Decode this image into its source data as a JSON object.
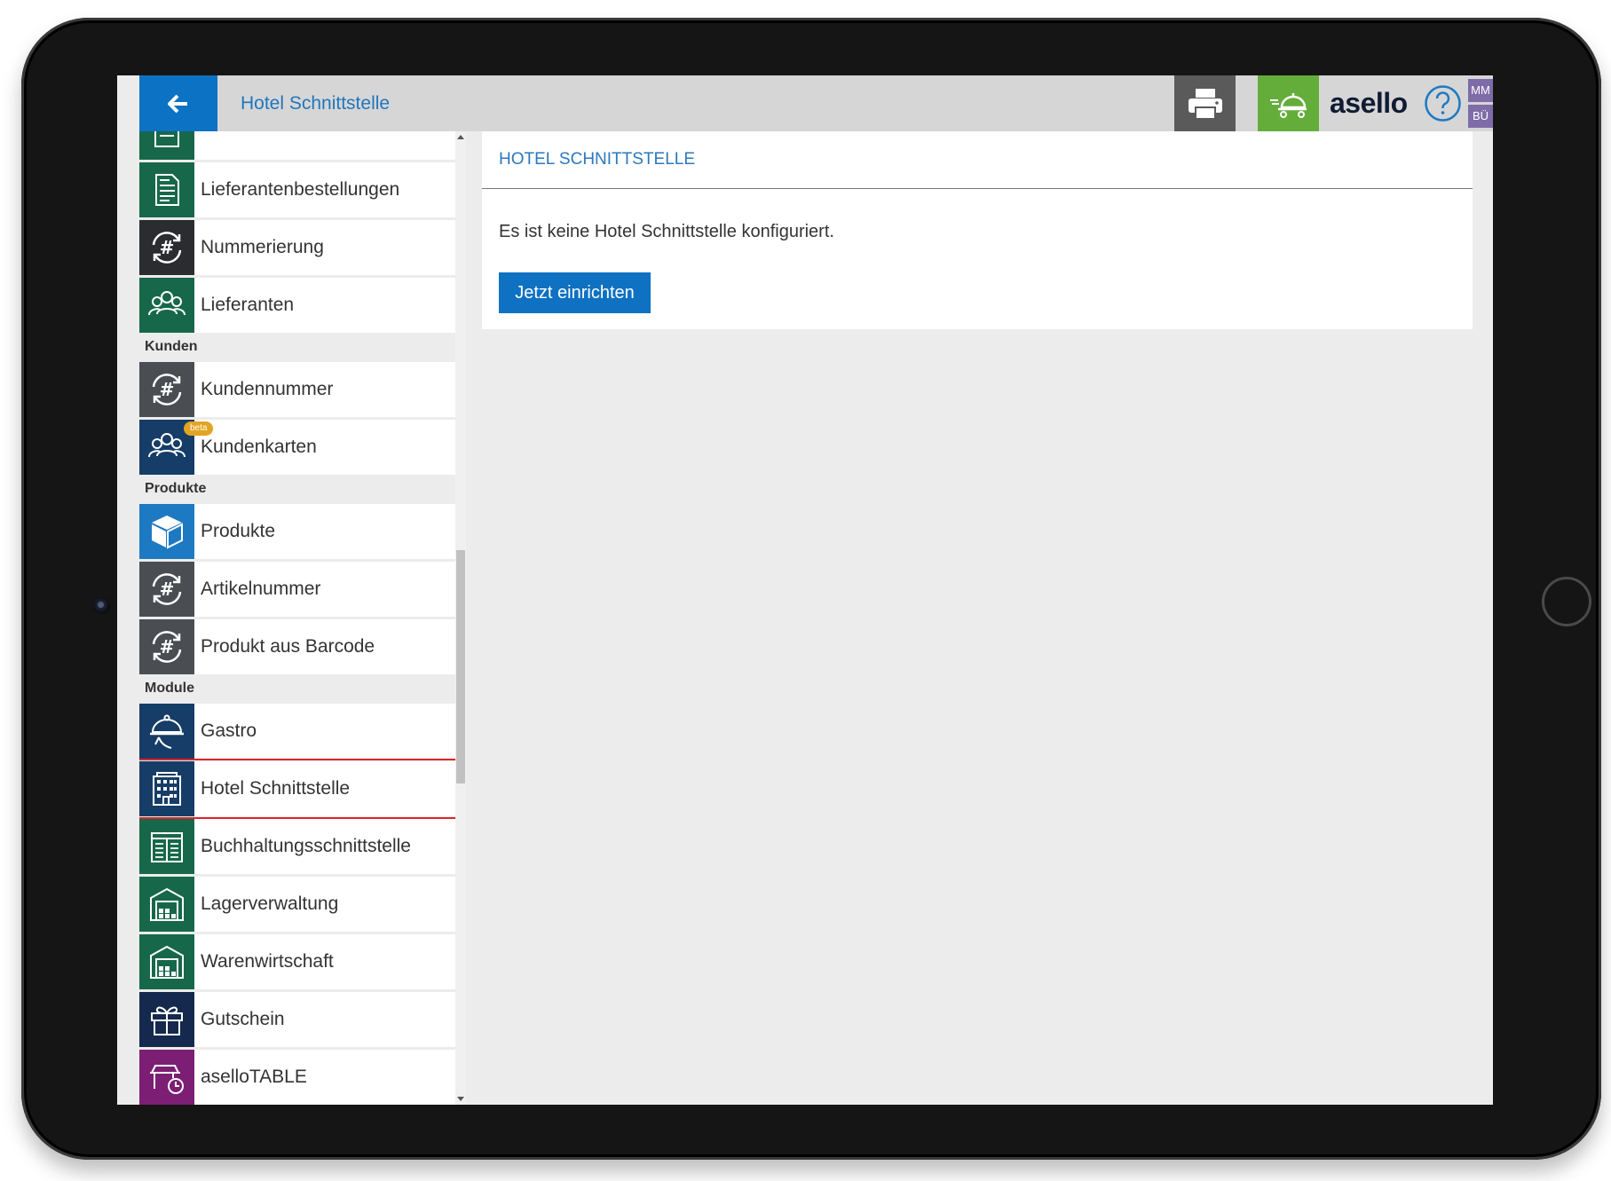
{
  "header": {
    "title": "Hotel Schnittstelle",
    "logo": "asello",
    "user_initials_top": "MM",
    "user_initials_bottom": "BÜ"
  },
  "sidebar": {
    "sections": [
      {
        "label": "",
        "items": [
          {
            "label": "",
            "icon": "document-list-icon",
            "color": "#17684b"
          },
          {
            "label": "Lieferantenbestellungen",
            "icon": "document-icon",
            "color": "#17684b"
          },
          {
            "label": "Nummerierung",
            "icon": "hash-refresh-icon",
            "color": "#2a2c30"
          },
          {
            "label": "Lieferanten",
            "icon": "people-icon",
            "color": "#17684b"
          }
        ]
      },
      {
        "label": "Kunden",
        "items": [
          {
            "label": "Kundennummer",
            "icon": "hash-refresh-icon",
            "color": "#4a4e53"
          },
          {
            "label": "Kundenkarten",
            "icon": "people-icon",
            "color": "#163d67",
            "badge": "beta"
          }
        ]
      },
      {
        "label": "Produkte",
        "items": [
          {
            "label": "Produkte",
            "icon": "box-icon",
            "color": "#1e79c3"
          },
          {
            "label": "Artikelnummer",
            "icon": "hash-refresh-icon",
            "color": "#4a4e53"
          },
          {
            "label": "Produkt aus Barcode",
            "icon": "hash-refresh-icon",
            "color": "#4a4e53"
          }
        ]
      },
      {
        "label": "Module",
        "items": [
          {
            "label": "Gastro",
            "icon": "cloche-icon",
            "color": "#163d67"
          },
          {
            "label": "Hotel Schnittstelle",
            "icon": "building-icon",
            "color": "#163d67",
            "active": true
          },
          {
            "label": "Buchhaltungsschnittstelle",
            "icon": "ledger-icon",
            "color": "#17684b"
          },
          {
            "label": "Lagerverwaltung",
            "icon": "warehouse-icon",
            "color": "#17684b"
          },
          {
            "label": "Warenwirtschaft",
            "icon": "warehouse-icon",
            "color": "#17684b"
          },
          {
            "label": "Gutschein",
            "icon": "gift-icon",
            "color": "#14294d"
          },
          {
            "label": "aselloTABLE",
            "icon": "table-clock-icon",
            "color": "#7c1f74"
          }
        ]
      }
    ]
  },
  "main": {
    "card_title": "HOTEL SCHNITTSTELLE",
    "message": "Es ist keine Hotel Schnittstelle konfiguriert.",
    "setup_button": "Jetzt einrichten"
  }
}
